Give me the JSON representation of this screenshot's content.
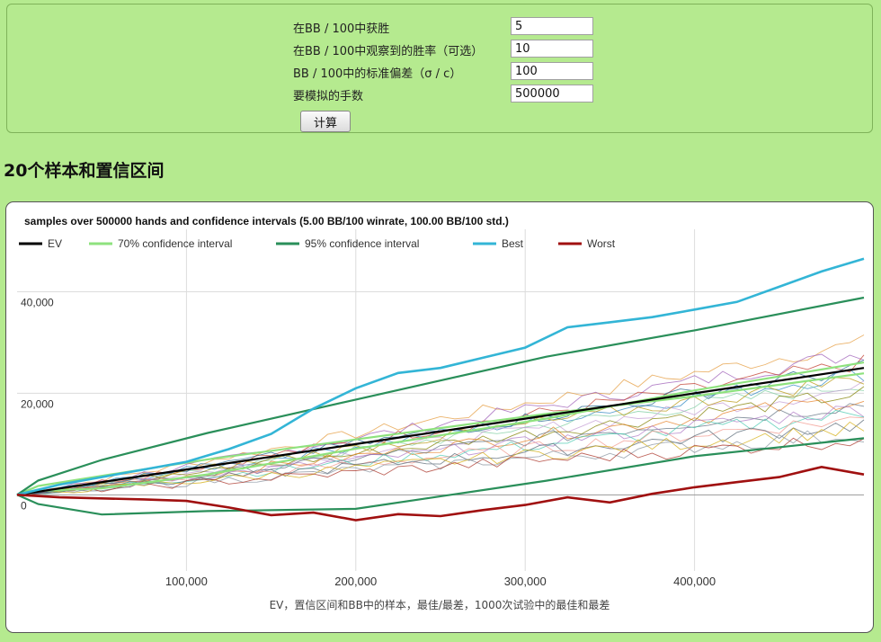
{
  "form": {
    "fields": [
      {
        "label": "在BB / 100中获胜",
        "value": "5"
      },
      {
        "label": "在BB / 100中观察到的胜率（可选）",
        "value": "10"
      },
      {
        "label": "BB / 100中的标准偏差（σ / c）",
        "value": "100"
      },
      {
        "label": "要模拟的手数",
        "value": "500000"
      }
    ],
    "calculate_label": "计算"
  },
  "section_title": "20个样本和置信区间",
  "chart_data": {
    "type": "line",
    "title": "samples over 500000 hands and confidence intervals (5.00 BB/100 winrate, 100.00 BB/100 std.)",
    "caption": "EV，置信区间和BB中的样本，最佳/最差，1000次试验中的最佳和最差",
    "legend_position": "top",
    "xlim": [
      0,
      500000
    ],
    "ylim": [
      -15000,
      47000
    ],
    "x_ticks": [
      100000,
      200000,
      300000,
      400000
    ],
    "x_tick_labels": [
      "100,000",
      "200,000",
      "300,000",
      "400,000"
    ],
    "y_ticks": [
      0,
      20000,
      40000
    ],
    "y_tick_labels": [
      "0",
      "20,000",
      "40,000"
    ],
    "grid": true,
    "series": [
      {
        "name": "EV",
        "color": "#000000",
        "x": [
          0,
          100000,
          200000,
          300000,
          400000,
          500000
        ],
        "y": [
          0,
          5000,
          10000,
          15000,
          20000,
          25000
        ]
      },
      {
        "name": "70% confidence interval",
        "color": "#8ee27e",
        "x": [
          0,
          12500,
          50000,
          112500,
          200000,
          312500,
          400000,
          500000
        ],
        "y_upper": [
          0,
          1743,
          3736,
          6979,
          10924,
          15969,
          19430,
          23929
        ],
        "y_lower": [
          0,
          757,
          1264,
          4021,
          9076,
          15031,
          20570,
          26071
        ]
      },
      {
        "name": "95% confidence interval",
        "color": "#2a8f5a",
        "x": [
          0,
          12500,
          50000,
          112500,
          200000,
          312500,
          400000,
          500000
        ],
        "y_upper": [
          0,
          2818,
          6883,
          12199,
          18765,
          27207,
          32396,
          38859
        ],
        "y_lower": [
          0,
          -1818,
          -3883,
          -3199,
          -2765,
          2793,
          7604,
          11141
        ]
      },
      {
        "name": "Best",
        "color": "#33b5d6",
        "x": [
          0,
          25000,
          50000,
          75000,
          100000,
          125000,
          150000,
          175000,
          200000,
          225000,
          250000,
          275000,
          300000,
          325000,
          350000,
          375000,
          400000,
          425000,
          450000,
          475000,
          500000
        ],
        "y": [
          0,
          2000,
          3500,
          5000,
          6500,
          9000,
          12000,
          17000,
          21000,
          24000,
          25000,
          27000,
          29000,
          33000,
          34000,
          35000,
          36500,
          38000,
          41000,
          44000,
          46500
        ]
      },
      {
        "name": "Worst",
        "color": "#a01010",
        "x": [
          0,
          25000,
          50000,
          75000,
          100000,
          125000,
          150000,
          175000,
          200000,
          225000,
          250000,
          275000,
          300000,
          325000,
          350000,
          375000,
          400000,
          425000,
          450000,
          475000,
          500000
        ],
        "y": [
          0,
          -500,
          -700,
          -900,
          -1200,
          -2500,
          -4000,
          -3500,
          -5000,
          -3800,
          -4200,
          -3000,
          -2000,
          -500,
          -1500,
          200,
          1500,
          2500,
          3500,
          5500,
          4000
        ]
      }
    ]
  }
}
